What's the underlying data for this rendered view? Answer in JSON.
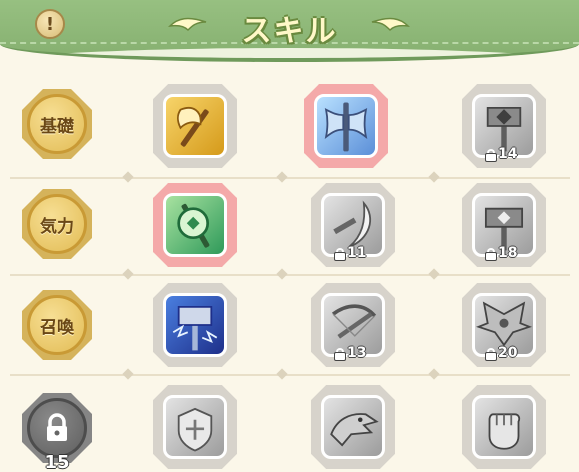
{
  "header": {
    "title": "スキル",
    "info_icon": "exclamation-icon",
    "info_glyph": "!"
  },
  "colors": {
    "header_green": "#8fba77",
    "background": "#fbf7e9",
    "badge_gold": "#e2bc55",
    "active_glow": "#f4a9a9"
  },
  "rows": [
    {
      "label": "基礎",
      "locked": false
    },
    {
      "label": "気力",
      "locked": false
    },
    {
      "label": "召喚",
      "locked": false
    },
    {
      "label": "",
      "locked": true,
      "unlock_level": "15"
    }
  ],
  "skills": [
    [
      {
        "icon": "golden-axe-icon",
        "active": false,
        "locked": false
      },
      {
        "icon": "ice-battle-axe-icon",
        "active": true,
        "locked": false
      },
      {
        "icon": "heavy-hammer-icon",
        "active": false,
        "locked": true,
        "unlock_level": "14"
      }
    ],
    [
      {
        "icon": "green-spirit-axe-icon",
        "active": true,
        "locked": false
      },
      {
        "icon": "crescent-blade-icon",
        "active": false,
        "locked": true,
        "unlock_level": "11"
      },
      {
        "icon": "guard-hammer-icon",
        "active": false,
        "locked": true,
        "unlock_level": "18"
      }
    ],
    [
      {
        "icon": "lightning-hammer-icon",
        "active": false,
        "locked": false
      },
      {
        "icon": "crossbow-icon",
        "active": false,
        "locked": true,
        "unlock_level": "13"
      },
      {
        "icon": "winged-demon-icon",
        "active": false,
        "locked": true,
        "unlock_level": "20"
      }
    ],
    [
      {
        "icon": "dragon-shield-icon",
        "active": false,
        "locked": true
      },
      {
        "icon": "dragon-head-icon",
        "active": false,
        "locked": true
      },
      {
        "icon": "raised-fist-icon",
        "active": false,
        "locked": true
      }
    ]
  ]
}
